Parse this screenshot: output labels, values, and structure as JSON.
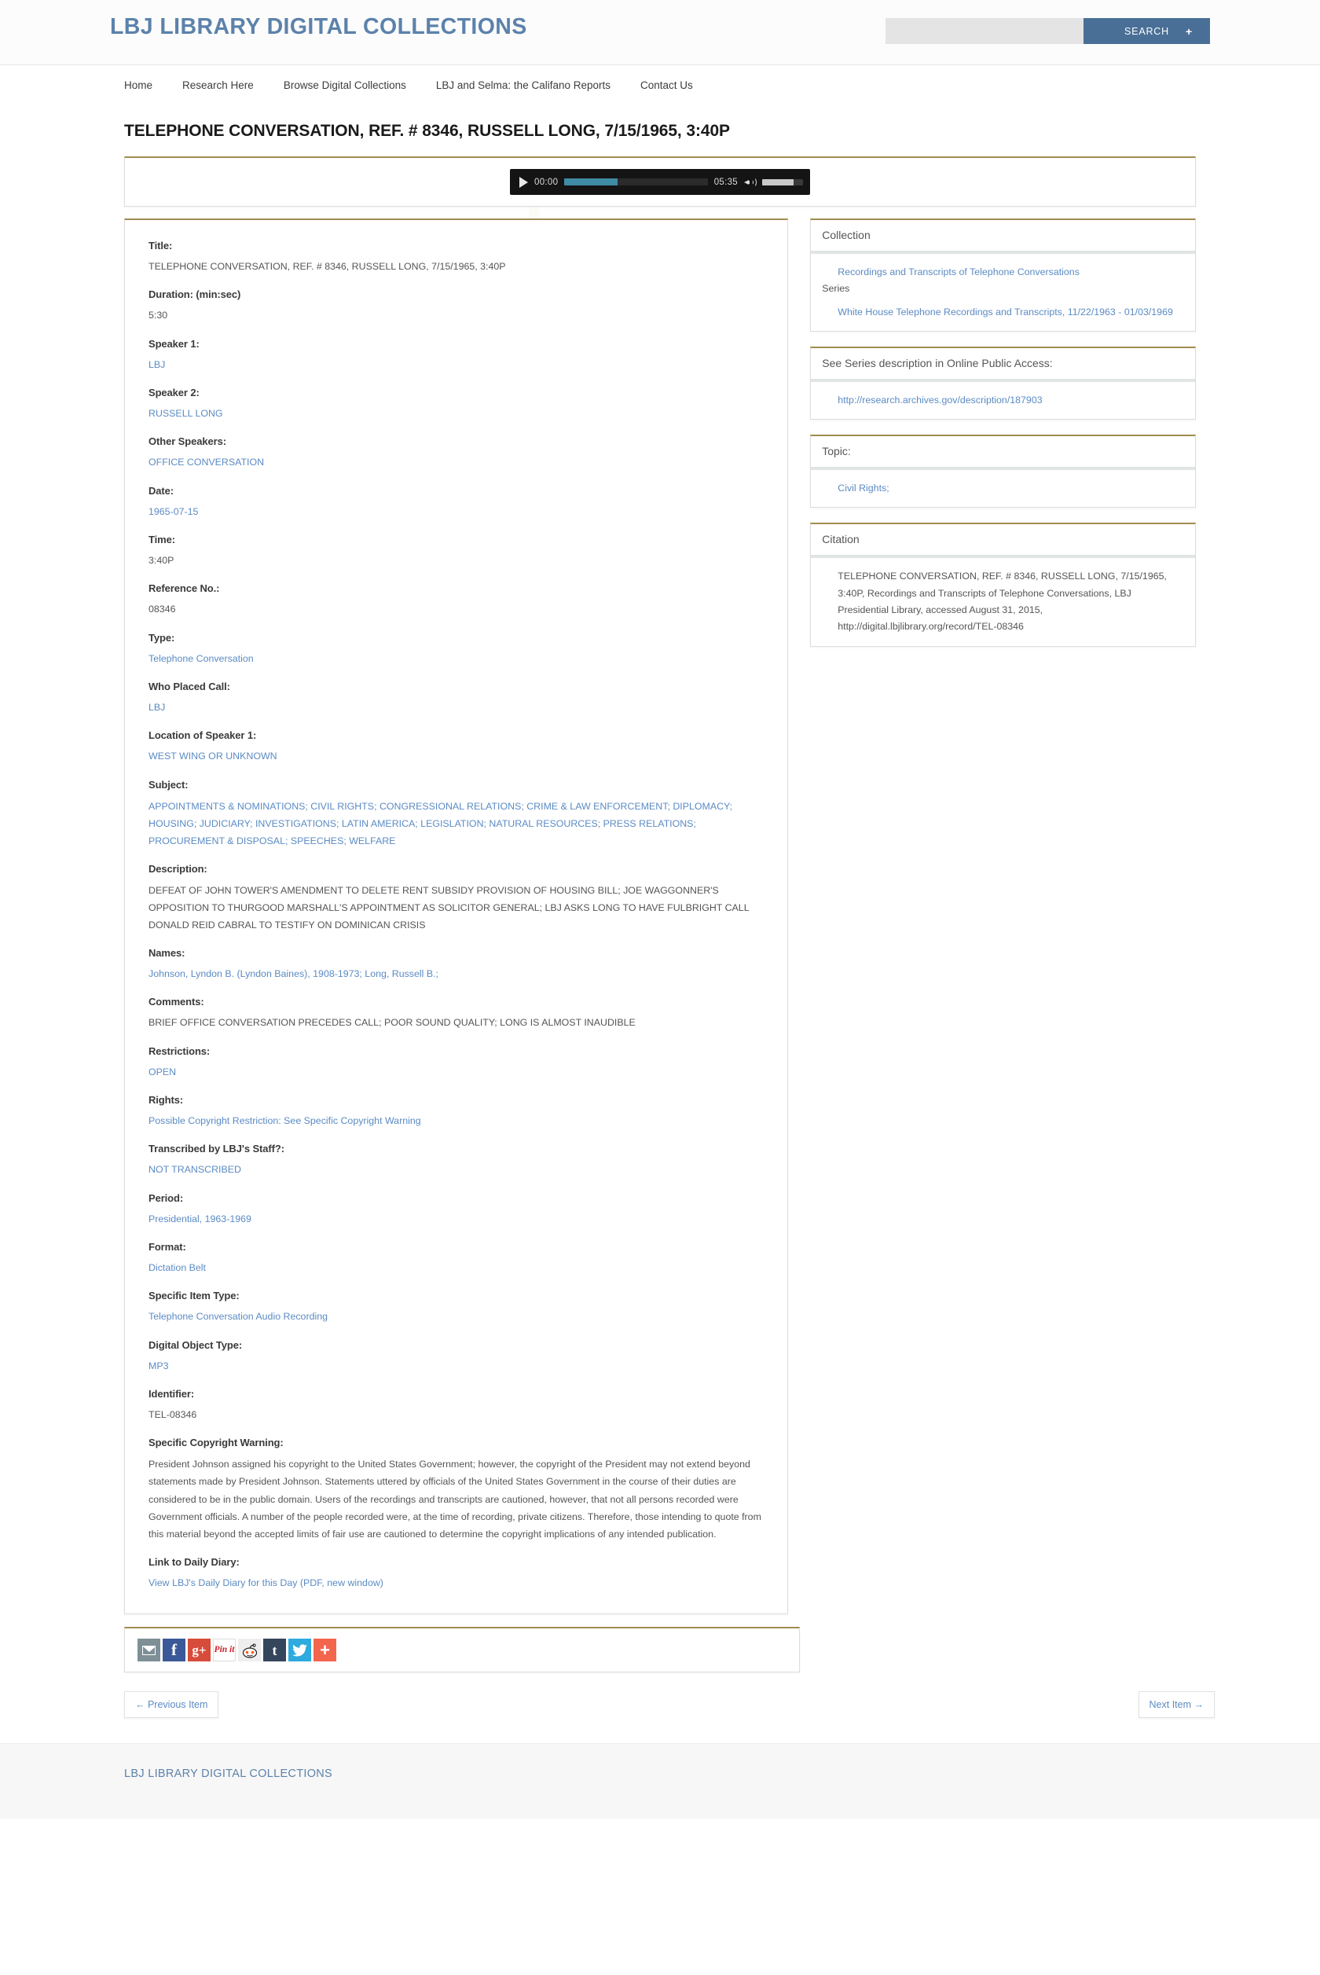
{
  "header": {
    "site_title": "LBJ LIBRARY DIGITAL COLLECTIONS",
    "search_placeholder": "",
    "search_value": "",
    "search_button": "SEARCH",
    "search_advanced_icon": "plus-icon",
    "accent_color": "#4a6f97",
    "link_color": "#5b8bc4",
    "panel_top_border_color": "#a08c4f"
  },
  "nav": {
    "items": [
      {
        "label": "Home"
      },
      {
        "label": "Research Here"
      },
      {
        "label": "Browse Digital Collections"
      },
      {
        "label": "LBJ and Selma: the Califano Reports"
      },
      {
        "label": "Contact Us"
      }
    ]
  },
  "page": {
    "title": "TELEPHONE CONVERSATION, REF. # 8346, RUSSELL LONG, 7/15/1965, 3:40P"
  },
  "player": {
    "play_icon": "play-icon",
    "current_time": "00:00",
    "total_time": "05:35",
    "volume_icon": "speaker-icon",
    "progress_percent": 37,
    "volume_percent": 76
  },
  "record": {
    "fields": [
      {
        "label": "Title:",
        "value": "TELEPHONE CONVERSATION, REF. # 8346, RUSSELL LONG, 7/15/1965, 3:40P",
        "is_link": false
      },
      {
        "label": "Duration: (min:sec)",
        "value": "5:30",
        "is_link": false
      },
      {
        "label": "Speaker 1:",
        "value": "LBJ",
        "is_link": true
      },
      {
        "label": "Speaker 2:",
        "value": "RUSSELL LONG",
        "is_link": true
      },
      {
        "label": "Other Speakers:",
        "value": "OFFICE CONVERSATION",
        "is_link": true
      },
      {
        "label": "Date:",
        "value": "1965-07-15",
        "is_link": true
      },
      {
        "label": "Time:",
        "value": "3:40P",
        "is_link": false
      },
      {
        "label": "Reference No.:",
        "value": "08346",
        "is_link": false
      },
      {
        "label": "Type:",
        "value": "Telephone Conversation",
        "is_link": true
      },
      {
        "label": "Who Placed Call:",
        "value": "LBJ",
        "is_link": true
      },
      {
        "label": "Location of Speaker 1:",
        "value": "WEST WING OR UNKNOWN",
        "is_link": true
      },
      {
        "label": "Subject:",
        "value": "APPOINTMENTS & NOMINATIONS; CIVIL RIGHTS; CONGRESSIONAL RELATIONS; CRIME & LAW ENFORCEMENT; DIPLOMACY; HOUSING; JUDICIARY; INVESTIGATIONS; LATIN AMERICA; LEGISLATION; NATURAL RESOURCES; PRESS RELATIONS; PROCUREMENT & DISPOSAL; SPEECHES; WELFARE",
        "is_link": true
      },
      {
        "label": "Description:",
        "value": "DEFEAT OF JOHN TOWER'S AMENDMENT TO DELETE RENT SUBSIDY PROVISION OF HOUSING BILL; JOE WAGGONNER'S OPPOSITION TO THURGOOD MARSHALL'S APPOINTMENT AS SOLICITOR GENERAL; LBJ ASKS LONG TO HAVE FULBRIGHT CALL DONALD REID CABRAL TO TESTIFY ON DOMINICAN CRISIS",
        "is_link": false
      },
      {
        "label": "Names:",
        "value": "Johnson, Lyndon B. (Lyndon Baines), 1908-1973; Long, Russell B.;",
        "is_link": true
      },
      {
        "label": "Comments:",
        "value": "BRIEF OFFICE CONVERSATION PRECEDES CALL; POOR SOUND QUALITY; LONG IS ALMOST INAUDIBLE",
        "is_link": false
      },
      {
        "label": "Restrictions:",
        "value": "OPEN",
        "is_link": true
      },
      {
        "label": "Rights:",
        "value": "Possible Copyright Restriction: See Specific Copyright Warning",
        "is_link": true
      },
      {
        "label": "Transcribed by LBJ's Staff?:",
        "value": "NOT TRANSCRIBED",
        "is_link": true
      },
      {
        "label": "Period:",
        "value": "Presidential, 1963-1969",
        "is_link": true
      },
      {
        "label": "Format:",
        "value": "Dictation Belt",
        "is_link": true
      },
      {
        "label": "Specific Item Type:",
        "value": "Telephone Conversation Audio Recording",
        "is_link": true
      },
      {
        "label": "Digital Object Type:",
        "value": "MP3",
        "is_link": true
      },
      {
        "label": "Identifier:",
        "value": "TEL-08346",
        "is_link": false
      },
      {
        "label": "Specific Copyright Warning:",
        "value": "President Johnson assigned his copyright to the United States Government; however, the copyright of the President may not extend beyond statements made by President Johnson. Statements uttered by officials of the United States Government in the course of their duties are considered to be in the public domain. Users of the recordings and transcripts are cautioned, however, that not all persons recorded were Government officials. A number of the people recorded were, at the time of recording, private citizens. Therefore, those intending to quote from this material beyond the accepted limits of fair use are cautioned to determine the copyright implications of any intended publication.",
        "is_link": false
      },
      {
        "label": "Link to Daily Diary:",
        "value": "View LBJ's Daily Diary for this Day (PDF, new window)",
        "is_link": true
      }
    ]
  },
  "sidebar": {
    "collection": {
      "heading": "Collection",
      "link": "Recordings and Transcripts of Telephone Conversations",
      "sub_label": "Series",
      "series_link": "White House Telephone Recordings and Transcripts, 11/22/1963 - 01/03/1969"
    },
    "opa": {
      "heading": "See Series description in Online Public Access:",
      "link": "http://research.archives.gov/description/187903"
    },
    "topic": {
      "heading": "Topic:",
      "link": "Civil Rights;"
    },
    "citation": {
      "heading": "Citation",
      "text": "TELEPHONE CONVERSATION, REF. # 8346, RUSSELL LONG, 7/15/1965, 3:40P, Recordings and Transcripts of Telephone Conversations, LBJ Presidential Library, accessed August 31, 2015, http://digital.lbjlibrary.org/record/TEL-08346"
    }
  },
  "share": {
    "buttons": [
      {
        "name": "email-share-icon",
        "label": ""
      },
      {
        "name": "facebook-share-icon",
        "label": "f"
      },
      {
        "name": "google-plus-share-icon",
        "label": "g+"
      },
      {
        "name": "pinterest-share-icon",
        "label": "Pin it"
      },
      {
        "name": "reddit-share-icon",
        "label": ""
      },
      {
        "name": "tumblr-share-icon",
        "label": "t"
      },
      {
        "name": "twitter-share-icon",
        "label": ""
      },
      {
        "name": "addthis-share-icon",
        "label": "+"
      }
    ]
  },
  "pager": {
    "previous": "← Previous Item",
    "next": "Next Item →"
  },
  "footer": {
    "title": "LBJ LIBRARY DIGITAL COLLECTIONS"
  }
}
